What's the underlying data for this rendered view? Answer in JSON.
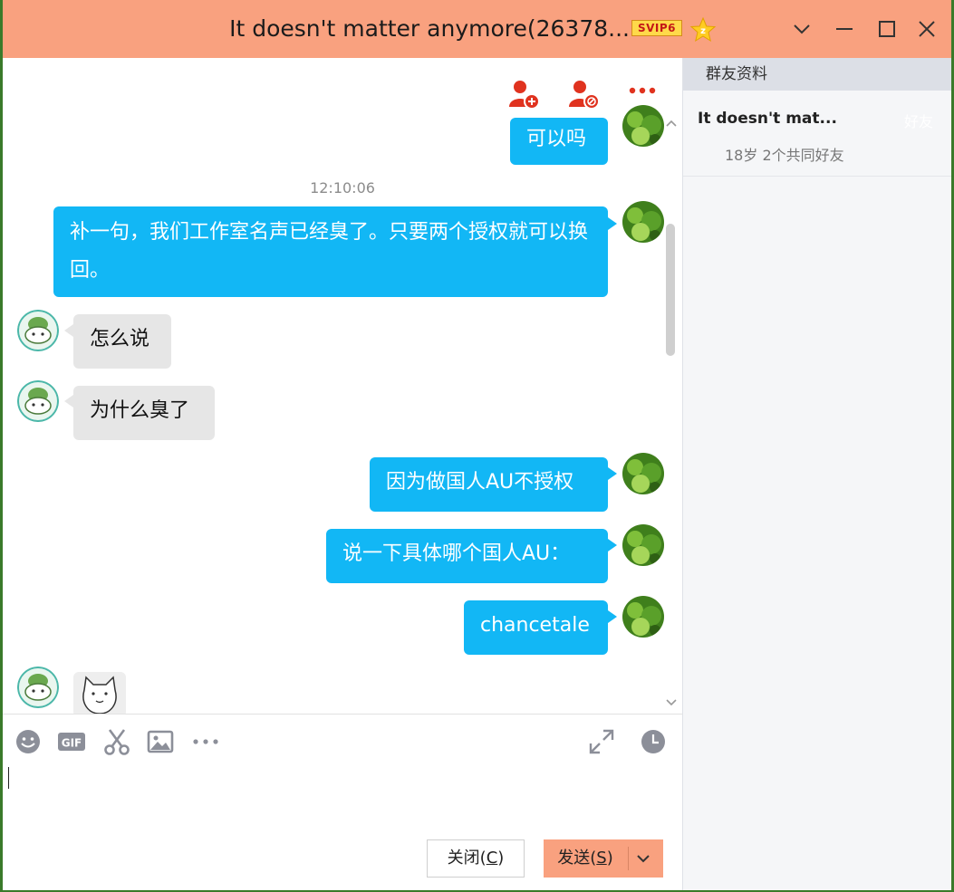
{
  "window": {
    "title": "It doesn't matter anymore(26378...",
    "vip_badge": "SVIP6"
  },
  "side_panel": {
    "header": "群友资料",
    "member": {
      "name": "It doesn't mat...",
      "tag": "好友",
      "info": "18岁  2个共同好友"
    }
  },
  "messages": [
    {
      "dir": "out",
      "text": "可以吗"
    },
    {
      "type": "time",
      "text": "12:10:06"
    },
    {
      "dir": "out",
      "text": "补一句，我们工作室名声已经臭了。只要两个授权就可以换回。"
    },
    {
      "dir": "in",
      "text": "怎么说"
    },
    {
      "dir": "in",
      "text": "为什么臭了"
    },
    {
      "dir": "out",
      "text": "因为做国人AU不授权"
    },
    {
      "dir": "out",
      "text": "说一下具体哪个国人AU："
    },
    {
      "dir": "out",
      "text": "chancetale"
    },
    {
      "dir": "in",
      "type": "sticker",
      "icon": "cat-sticker-icon"
    }
  ],
  "composer": {
    "value": "",
    "close_label_main": "关闭(",
    "close_key": "C",
    "close_label_end": ")",
    "send_label_main": "发送(",
    "send_key": "S",
    "send_label_end": ")"
  },
  "colors": {
    "titlebar": "#f9a17f",
    "outgoing_bubble": "#12b7f5",
    "incoming_bubble": "#e6e6e6",
    "action_icons": "#e0331f"
  }
}
